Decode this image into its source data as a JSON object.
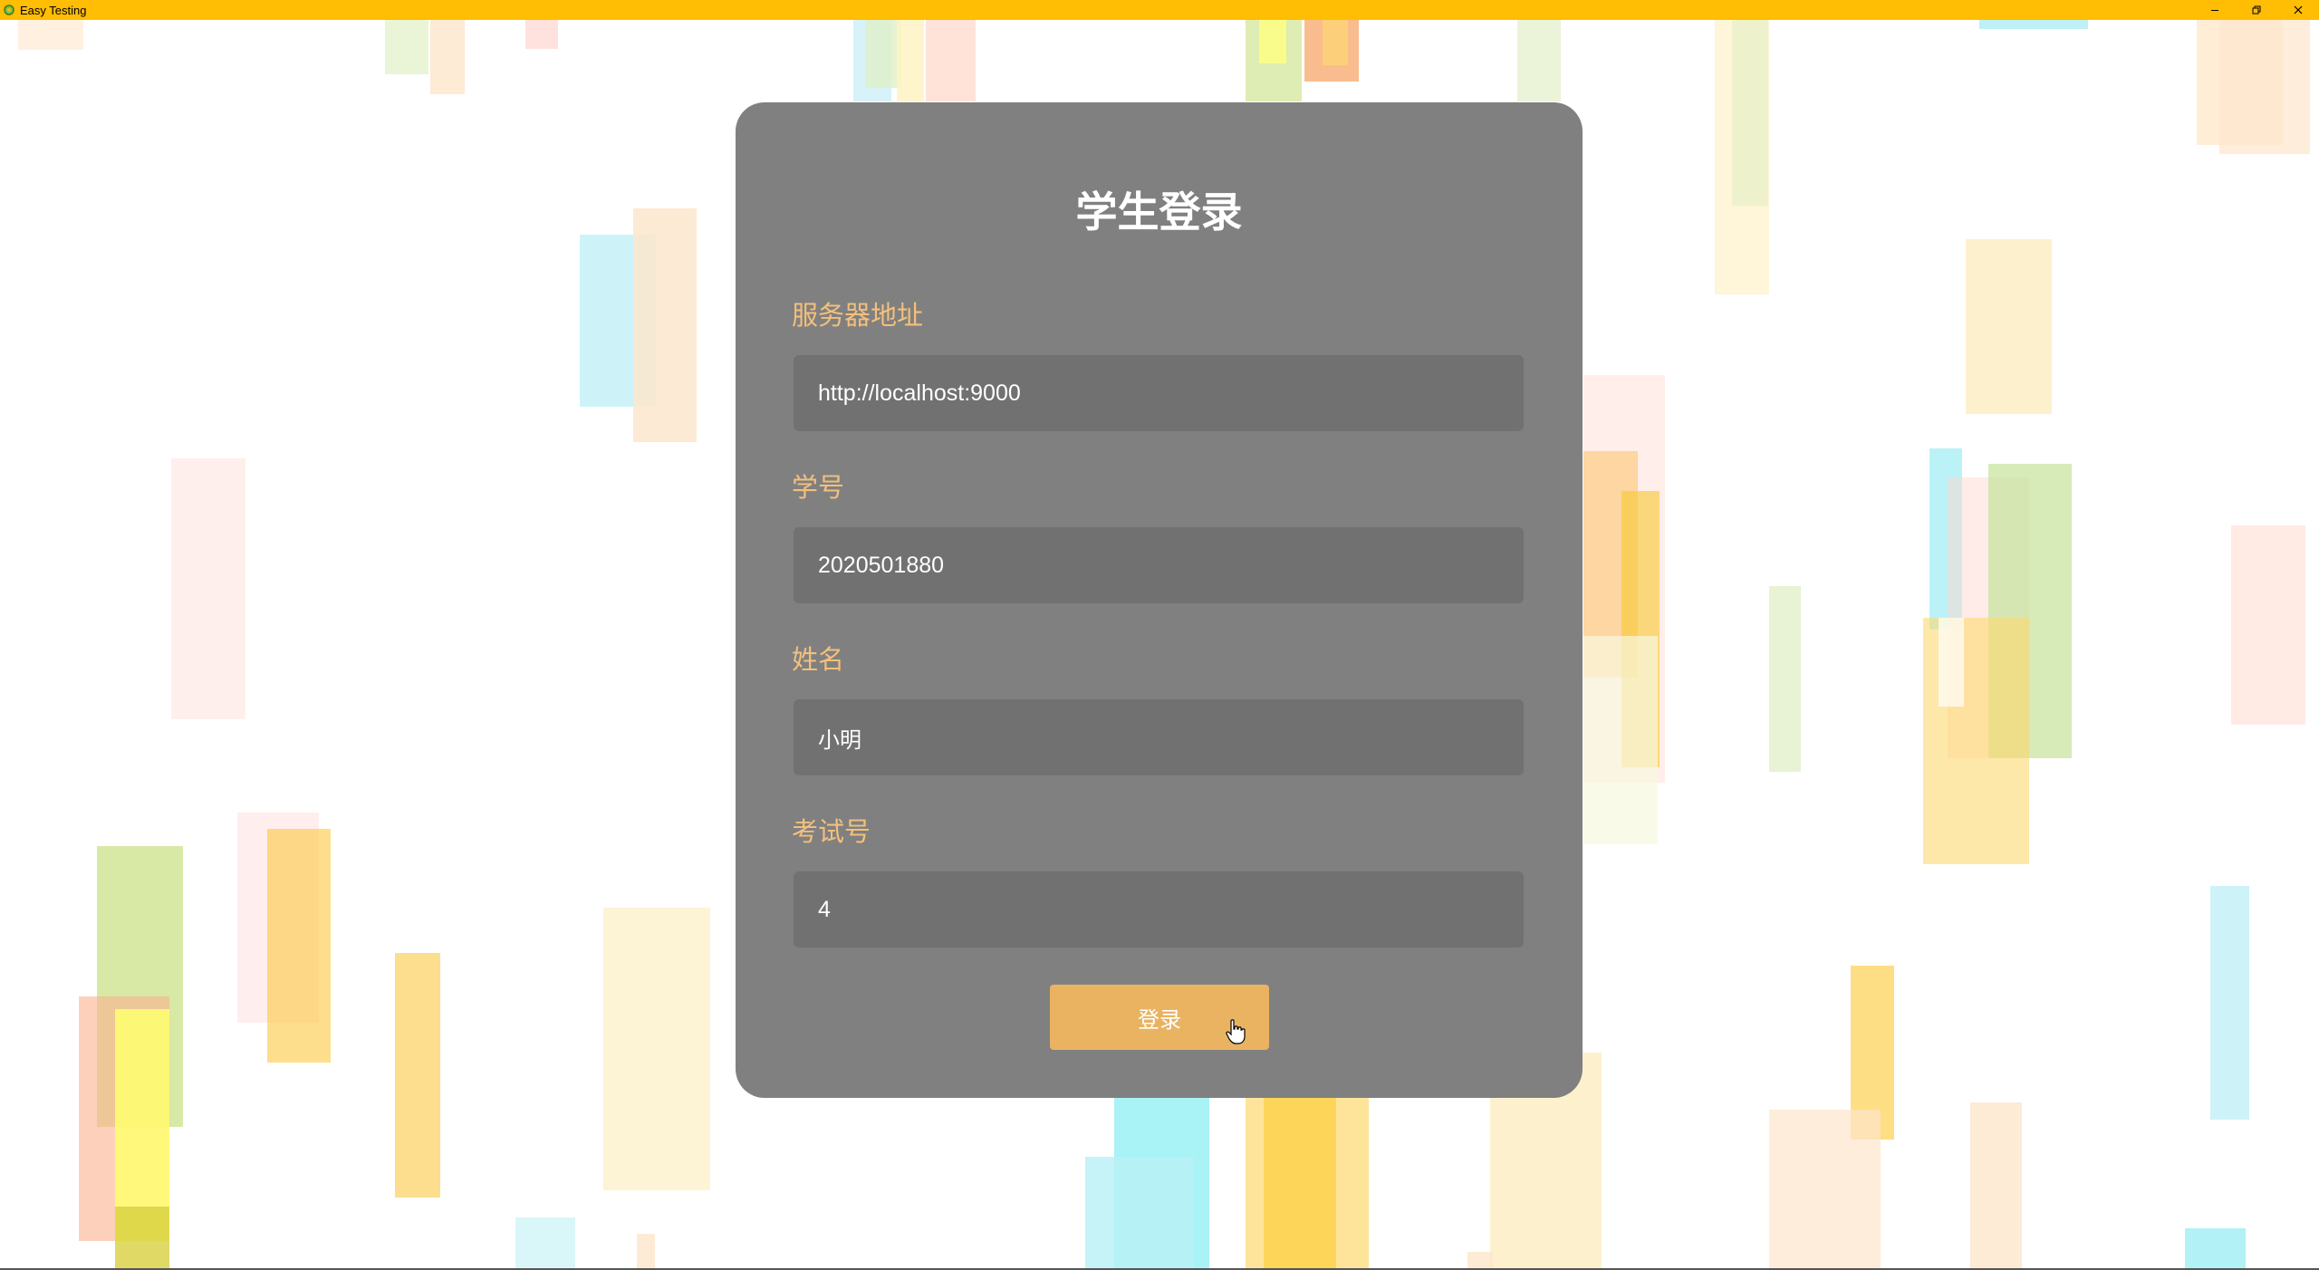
{
  "window": {
    "title": "Easy Testing",
    "app_icon": "gear-icon",
    "controls": [
      "minimize-icon",
      "restore-icon",
      "close-icon"
    ],
    "titlebar_color": "#ffbd03"
  },
  "form": {
    "title": "学生登录",
    "fields": [
      {
        "label": "服务器地址",
        "value": "http://localhost:9000"
      },
      {
        "label": "学号",
        "value": "2020501880"
      },
      {
        "label": "姓名",
        "value": "小明"
      },
      {
        "label": "考试号",
        "value": "4"
      }
    ],
    "submit_label": "登录"
  },
  "colors": {
    "card_background": "#808080",
    "input_background": "#717171",
    "label_color": "#f3c07b",
    "button_color": "#e9b362"
  }
}
